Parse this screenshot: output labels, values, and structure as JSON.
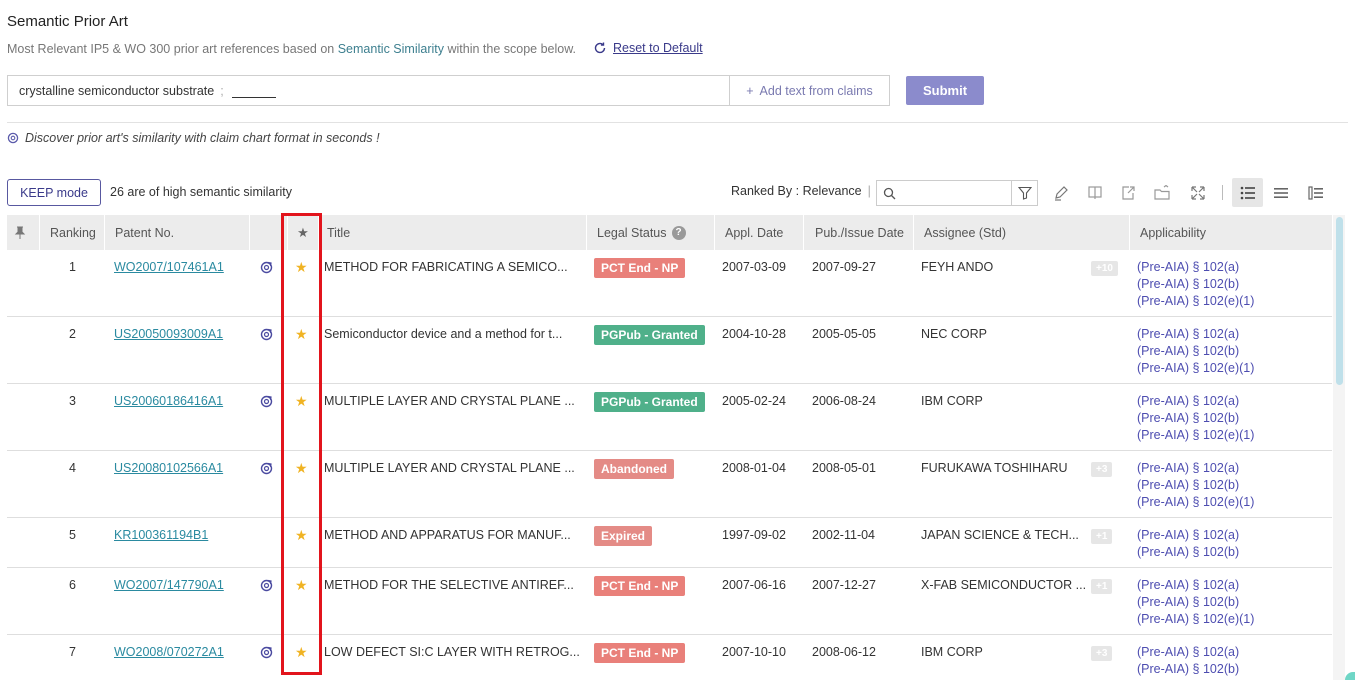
{
  "header": {
    "title": "Semantic Prior Art",
    "subtitle_prefix": "Most Relevant IP5 & WO 300 prior art references based on ",
    "subtitle_link": "Semantic Similarity",
    "subtitle_suffix": " within the scope below.",
    "reset_label": "Reset to Default"
  },
  "search": {
    "query": "crystalline semiconductor substrate",
    "separator": ";",
    "add_claims_label": "Add text from claims",
    "submit_label": "Submit"
  },
  "discover_text": "Discover prior art's similarity with claim chart format in seconds !",
  "toolbar": {
    "keep_mode_label": "KEEP mode",
    "high_similarity_text": "26 are of high semantic similarity",
    "ranked_by": "Ranked By : Relevance",
    "filter_placeholder": ""
  },
  "table": {
    "headers": {
      "ranking": "Ranking",
      "patent_no": "Patent No.",
      "title": "Title",
      "legal_status": "Legal Status",
      "appl_date": "Appl. Date",
      "pub_date": "Pub./Issue Date",
      "assignee": "Assignee (Std)",
      "applicability": "Applicability"
    },
    "rows": [
      {
        "rank": "1",
        "patent": "WO2007/107461A1",
        "sim": true,
        "title": "METHOD FOR FABRICATING A SEMICO...",
        "legal": "PCT End - NP",
        "appl": "2007-03-09",
        "pub": "2007-09-27",
        "assignee": "FEYH ANDO",
        "plus": "+10",
        "app": [
          "(Pre-AIA) § 102(a)",
          "(Pre-AIA) § 102(b)",
          "(Pre-AIA) § 102(e)(1)"
        ]
      },
      {
        "rank": "2",
        "patent": "US20050093009A1",
        "sim": true,
        "title": "Semiconductor device and a method for t...",
        "legal": "PGPub - Granted",
        "appl": "2004-10-28",
        "pub": "2005-05-05",
        "assignee": "NEC CORP",
        "plus": "",
        "app": [
          "(Pre-AIA) § 102(a)",
          "(Pre-AIA) § 102(b)",
          "(Pre-AIA) § 102(e)(1)"
        ]
      },
      {
        "rank": "3",
        "patent": "US20060186416A1",
        "sim": true,
        "title": "MULTIPLE LAYER AND CRYSTAL PLANE ...",
        "legal": "PGPub - Granted",
        "appl": "2005-02-24",
        "pub": "2006-08-24",
        "assignee": "IBM CORP",
        "plus": "",
        "app": [
          "(Pre-AIA) § 102(a)",
          "(Pre-AIA) § 102(b)",
          "(Pre-AIA) § 102(e)(1)"
        ]
      },
      {
        "rank": "4",
        "patent": "US20080102566A1",
        "sim": true,
        "title": "MULTIPLE LAYER AND CRYSTAL PLANE ...",
        "legal": "Abandoned",
        "appl": "2008-01-04",
        "pub": "2008-05-01",
        "assignee": "FURUKAWA TOSHIHARU",
        "plus": "+3",
        "app": [
          "(Pre-AIA) § 102(a)",
          "(Pre-AIA) § 102(b)",
          "(Pre-AIA) § 102(e)(1)"
        ]
      },
      {
        "rank": "5",
        "patent": "KR100361194B1",
        "sim": false,
        "title": "METHOD AND APPARATUS FOR MANUF...",
        "legal": "Expired",
        "appl": "1997-09-02",
        "pub": "2002-11-04",
        "assignee": "JAPAN SCIENCE & TECH...",
        "plus": "+1",
        "app": [
          "(Pre-AIA) § 102(a)",
          "(Pre-AIA) § 102(b)"
        ]
      },
      {
        "rank": "6",
        "patent": "WO2007/147790A1",
        "sim": true,
        "title": "METHOD FOR THE SELECTIVE ANTIREF...",
        "legal": "PCT End - NP",
        "appl": "2007-06-16",
        "pub": "2007-12-27",
        "assignee": "X-FAB SEMICONDUCTOR ...",
        "plus": "+1",
        "app": [
          "(Pre-AIA) § 102(a)",
          "(Pre-AIA) § 102(b)",
          "(Pre-AIA) § 102(e)(1)"
        ]
      },
      {
        "rank": "7",
        "patent": "WO2008/070272A1",
        "sim": true,
        "title": "LOW DEFECT SI:C LAYER WITH RETROG...",
        "legal": "PCT End - NP",
        "appl": "2007-10-10",
        "pub": "2008-06-12",
        "assignee": "IBM CORP",
        "plus": "+3",
        "app": [
          "(Pre-AIA) § 102(a)",
          "(Pre-AIA) § 102(b)"
        ]
      }
    ]
  },
  "colors": {
    "accent": "#8b8bcc",
    "link": "#2a8aa0",
    "star": "#f0b323",
    "highlight": "#e2141c",
    "status_np": "#e9807a",
    "status_granted": "#4fb08a"
  }
}
